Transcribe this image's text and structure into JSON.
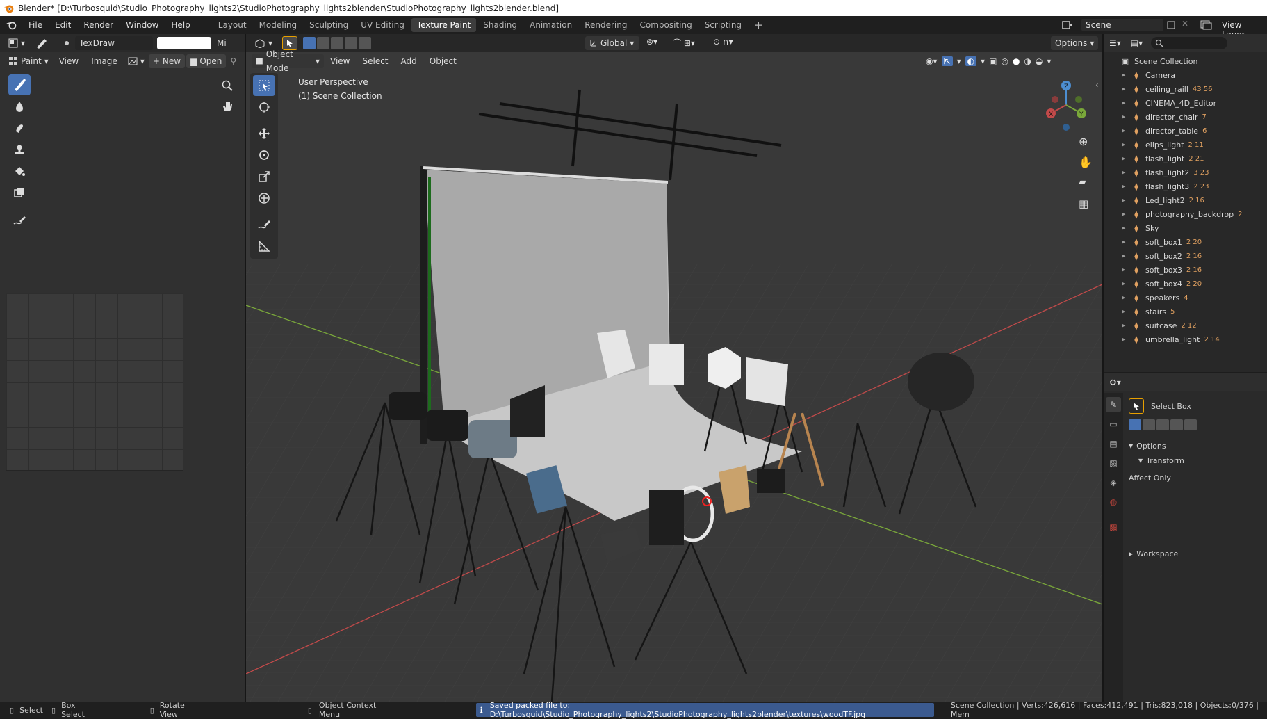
{
  "window": {
    "title": "Blender* [D:\\Turbosquid\\Studio_Photography_lights2\\StudioPhotography_lights2blender\\StudioPhotography_lights2blender.blend]"
  },
  "menu": [
    "File",
    "Edit",
    "Render",
    "Window",
    "Help"
  ],
  "workspaces": [
    "Layout",
    "Modeling",
    "Sculpting",
    "UV Editing",
    "Texture Paint",
    "Shading",
    "Animation",
    "Rendering",
    "Compositing",
    "Scripting"
  ],
  "active_workspace": "Texture Paint",
  "scene": {
    "name": "Scene",
    "view_layer": "View Layer"
  },
  "image_editor": {
    "brush_name": "TexDraw",
    "mix_label": "Mi",
    "mode": "Paint",
    "menus": [
      "View",
      "Image"
    ],
    "new_label": "New",
    "open_label": "Open"
  },
  "viewport": {
    "mode": "Object Mode",
    "menus": [
      "View",
      "Select",
      "Add",
      "Object"
    ],
    "orientation": "Global",
    "options_label": "Options",
    "overlay_line1": "User Perspective",
    "overlay_line2": "(1) Scene Collection"
  },
  "outliner": {
    "root": "Scene Collection",
    "items": [
      {
        "name": "Camera",
        "badge": ""
      },
      {
        "name": "ceiling_raill",
        "badge": "43 56"
      },
      {
        "name": "CINEMA_4D_Editor",
        "badge": ""
      },
      {
        "name": "director_chair",
        "badge": "7"
      },
      {
        "name": "director_table",
        "badge": "6"
      },
      {
        "name": "elips_light",
        "badge": "2 11"
      },
      {
        "name": "flash_light",
        "badge": "2 21"
      },
      {
        "name": "flash_light2",
        "badge": "3 23"
      },
      {
        "name": "flash_light3",
        "badge": "2 23"
      },
      {
        "name": "Led_light2",
        "badge": "2 16"
      },
      {
        "name": "photography_backdrop",
        "badge": "2"
      },
      {
        "name": "Sky",
        "badge": ""
      },
      {
        "name": "soft_box1",
        "badge": "2 20"
      },
      {
        "name": "soft_box2",
        "badge": "2 16"
      },
      {
        "name": "soft_box3",
        "badge": "2 16"
      },
      {
        "name": "soft_box4",
        "badge": "2 20"
      },
      {
        "name": "speakers",
        "badge": "4"
      },
      {
        "name": "stairs",
        "badge": "5"
      },
      {
        "name": "suitcase",
        "badge": "2 12"
      },
      {
        "name": "umbrella_light",
        "badge": "2 14"
      }
    ]
  },
  "properties": {
    "tool_name": "Select Box",
    "options_label": "Options",
    "transform_label": "Transform",
    "affect_only_label": "Affect Only",
    "workspace_label": "Workspace"
  },
  "status": {
    "select": "Select",
    "box_select": "Box Select",
    "rotate_view": "Rotate View",
    "context_menu": "Object Context Menu",
    "message": "Saved packed file to: D:\\Turbosquid\\Studio_Photography_lights2\\StudioPhotography_lights2blender\\textures\\woodTF.jpg",
    "stats": "Scene Collection | Verts:426,616 | Faces:412,491 | Tris:823,018 | Objects:0/376 | Mem"
  },
  "colors": {
    "accent": "#4772b3",
    "info_bg": "#3b5a8f",
    "x_axis": "#c24a4a",
    "y_axis": "#7aa83a"
  }
}
